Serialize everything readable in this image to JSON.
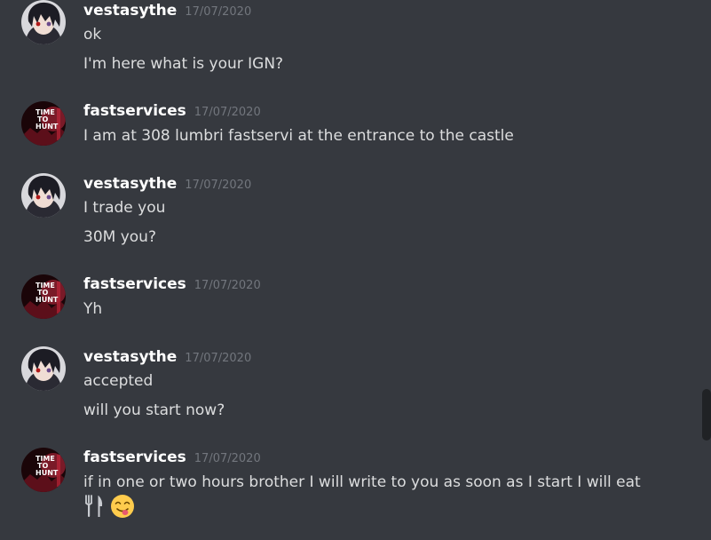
{
  "colors": {
    "background": "#36393f",
    "username": "#ffffff",
    "timestamp": "#72767d",
    "text": "#dcddde",
    "scrollbar": "#202225"
  },
  "messages": [
    {
      "username": "vestasythe",
      "timestamp": "17/07/2020",
      "avatar_icon": "anime-character-avatar",
      "lines": [
        "ok",
        "I'm here what is your IGN?"
      ]
    },
    {
      "username": "fastservices",
      "timestamp": "17/07/2020",
      "avatar_icon": "time-to-hunt-avatar",
      "avatar_text": [
        "TIME",
        "TO",
        "HUNT"
      ],
      "lines": [
        "I am at 308 lumbri fastservi at the entrance to the castle"
      ]
    },
    {
      "username": "vestasythe",
      "timestamp": "17/07/2020",
      "avatar_icon": "anime-character-avatar",
      "lines": [
        "I trade you",
        "30M you?"
      ]
    },
    {
      "username": "fastservices",
      "timestamp": "17/07/2020",
      "avatar_icon": "time-to-hunt-avatar",
      "avatar_text": [
        "TIME",
        "TO",
        "HUNT"
      ],
      "lines": [
        "Yh"
      ]
    },
    {
      "username": "vestasythe",
      "timestamp": "17/07/2020",
      "avatar_icon": "anime-character-avatar",
      "lines": [
        "accepted",
        "will you start now?"
      ]
    },
    {
      "username": "fastservices",
      "timestamp": "17/07/2020",
      "avatar_icon": "time-to-hunt-avatar",
      "avatar_text": [
        "TIME",
        "TO",
        "HUNT"
      ],
      "lines": [
        "if in one or two hours brother I will write to you as soon as I start I will eat"
      ],
      "emojis": [
        "fork-and-knife-icon",
        "yum-face-icon"
      ]
    }
  ]
}
